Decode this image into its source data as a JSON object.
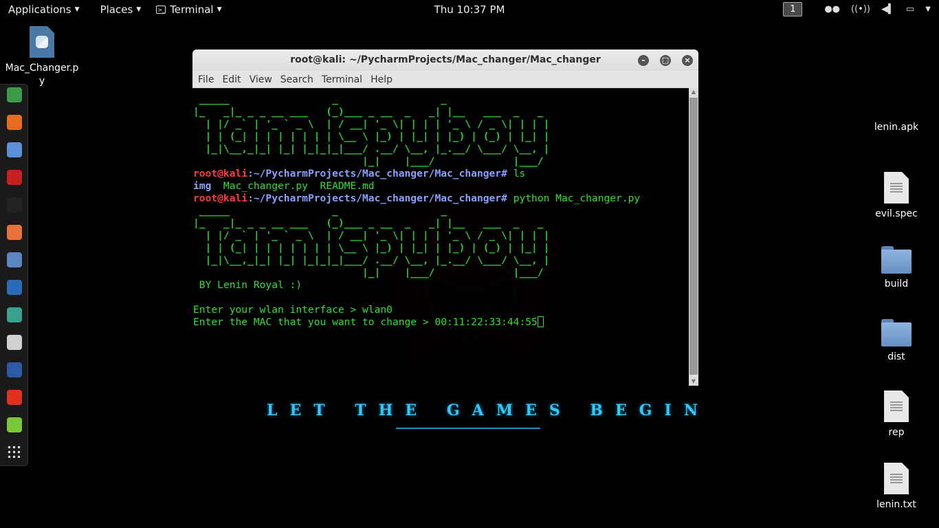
{
  "topbar": {
    "applications": "Applications",
    "places": "Places",
    "terminal": "Terminal",
    "clock": "Thu 10:37 PM",
    "workspace": "1"
  },
  "wallpaper": {
    "tagline": "LET THE GAMES BEGIN"
  },
  "dock": {
    "items": [
      {
        "name": "maltego",
        "color": "#3c9a4a"
      },
      {
        "name": "firefox",
        "color": "#e96b1f"
      },
      {
        "name": "chrome",
        "color": "#5b8fd6"
      },
      {
        "name": "armitage",
        "color": "#c82020"
      },
      {
        "name": "terminal",
        "color": "#222222"
      },
      {
        "name": "burpsuite",
        "color": "#e8703a"
      },
      {
        "name": "files",
        "color": "#5b86c2"
      },
      {
        "name": "metasploit",
        "color": "#2a6ab8"
      },
      {
        "name": "beef",
        "color": "#3aa08a"
      },
      {
        "name": "faraday",
        "color": "#d0d0d0"
      },
      {
        "name": "zap",
        "color": "#2a5aa8"
      },
      {
        "name": "flashfire",
        "color": "#e03020"
      },
      {
        "name": "notes",
        "color": "#7cc63a"
      },
      {
        "name": "show-apps",
        "color": "#1a1a1a"
      }
    ]
  },
  "desktop": {
    "left_icon": "Mac_Changer.py",
    "right_icons": [
      "lenin.apk",
      "evil.spec",
      "build",
      "dist",
      "rep",
      "lenin.txt"
    ]
  },
  "terminal": {
    "title": "root@kali: ~/PycharmProjects/Mac_changer/Mac_changer",
    "menu": [
      "File",
      "Edit",
      "View",
      "Search",
      "Terminal",
      "Help"
    ],
    "banner": [
      " _____                 _                 _",
      "|_   _|_ _ _ __ ___   (_)___ _ __  _   _| |__   ___  _   _",
      "  | |/ _` | '_ ` _ \\  | / __| '_ \\| | | | '_ \\ / _ \\| | | |",
      "  | | (_| | | | | | | | \\__ \\ |_) | |_| | |_) | (_) | |_| |",
      "  |_|\\__,_|_| |_| |_|_|_|___/ .__/ \\__, |_.__/ \\___/ \\__, |",
      "                            |_|    |___/             |___/"
    ],
    "prompt_user": "root@kali",
    "prompt_path": ":~/PycharmProjects/Mac_changer/Mac_changer",
    "prompt_hash": "#",
    "cmd1": " ls",
    "ls_dir": "img",
    "ls_files": "  Mac_changer.py  README.md",
    "cmd2": " python Mac_changer.py",
    "author": " BY Lenin Royal :)",
    "line_iface": "Enter your wlan interface > wlan0",
    "line_mac": "Enter the MAC that you want to change > 00:11:22:33:44:55"
  }
}
